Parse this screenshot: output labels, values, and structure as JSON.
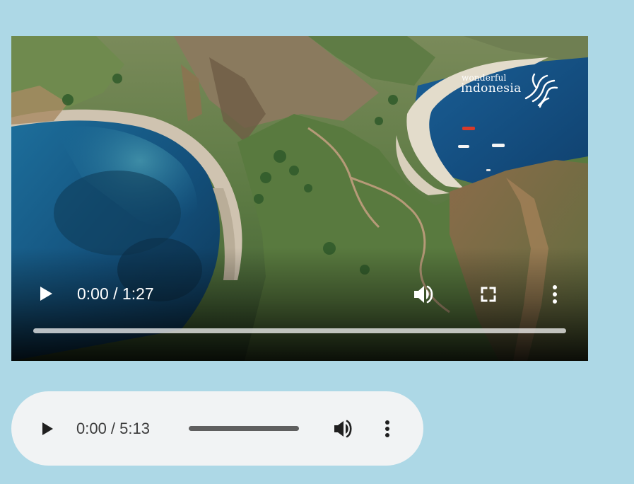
{
  "video": {
    "time_display": "0:00 / 1:27",
    "progress_fraction": 0,
    "logo": {
      "line1": "wonderful",
      "line2": "indonesia"
    },
    "icons": {
      "play": "play-icon",
      "volume": "volume-icon",
      "fullscreen": "fullscreen-icon",
      "more": "more-vert-icon"
    }
  },
  "audio": {
    "time_display": "0:00 / 5:13",
    "progress_fraction": 0,
    "icons": {
      "play": "play-icon",
      "volume": "volume-icon",
      "more": "more-vert-icon"
    }
  },
  "colors": {
    "page_background": "#add8e6",
    "audio_background": "#f1f3f4",
    "video_control_color": "#ffffff",
    "audio_control_color": "#1f1f1f"
  }
}
